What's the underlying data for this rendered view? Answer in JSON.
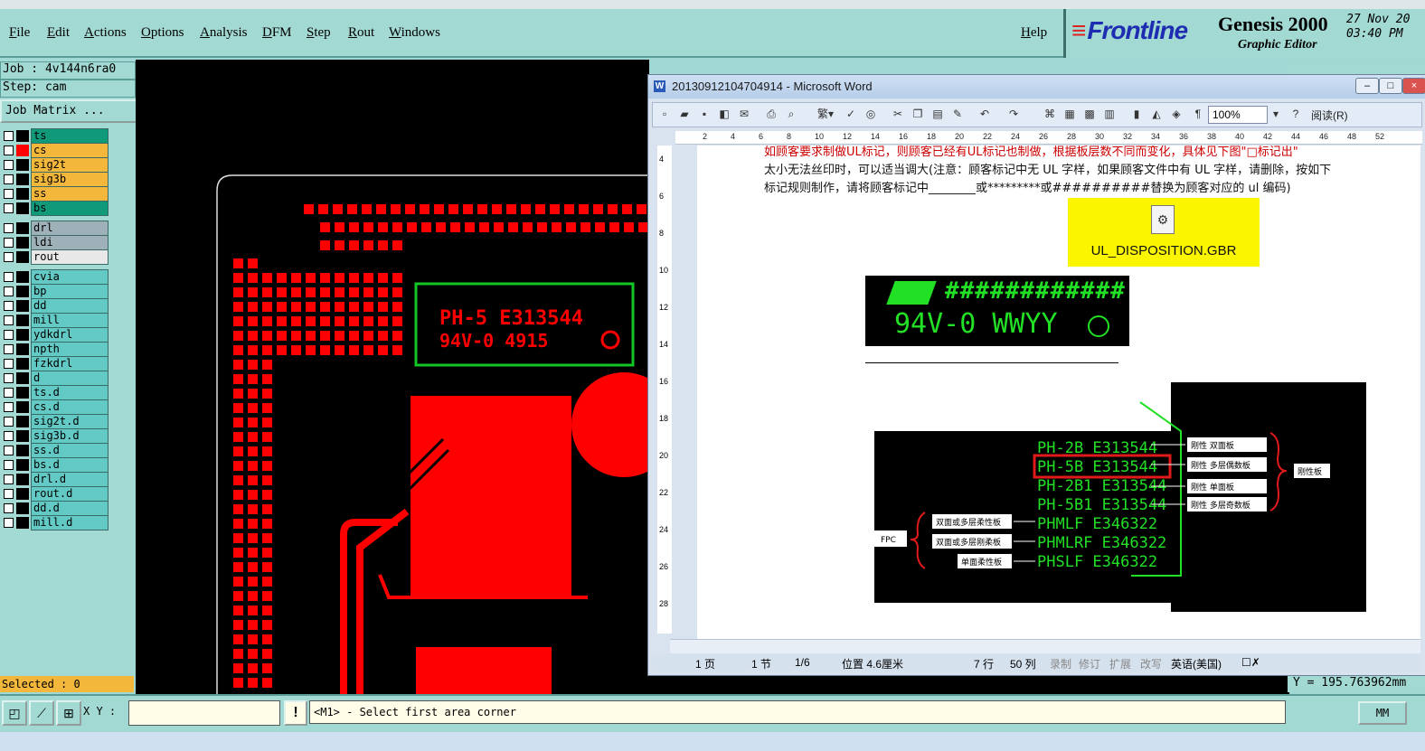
{
  "menu": {
    "items": [
      "File",
      "Edit",
      "Actions",
      "Options",
      "Analysis",
      "DFM",
      "Step",
      "Rout",
      "Windows"
    ],
    "help": "Help"
  },
  "brand": {
    "logo": "Frontline",
    "title": "Genesis 2000",
    "subtitle": "Graphic Editor",
    "date": "27 Nov 20",
    "time": "03:40 PM"
  },
  "left": {
    "job": "Job : 4v144n6ra0",
    "step": "Step: cam",
    "job_matrix": "Job Matrix ...",
    "selected": "Selected : 0",
    "layer_groups": [
      [
        {
          "name": "ts",
          "color": "#119a7a",
          "swatch": "#000000"
        },
        {
          "name": "cs",
          "color": "#f3b73b",
          "swatch": "#ff0000",
          "active": true
        },
        {
          "name": "sig2t",
          "color": "#f3b73b",
          "swatch": "#000000"
        },
        {
          "name": "sig3b",
          "color": "#f3b73b",
          "swatch": "#000000"
        },
        {
          "name": "ss",
          "color": "#f3b73b",
          "swatch": "#000000"
        },
        {
          "name": "bs",
          "color": "#119a7a",
          "swatch": "#000000"
        }
      ],
      [
        {
          "name": "drl",
          "color": "#9fb1b8",
          "swatch": "#000000"
        },
        {
          "name": "ldi",
          "color": "#9fb1b8",
          "swatch": "#000000"
        },
        {
          "name": "rout",
          "color": "#e8e8e8",
          "swatch": "#000000"
        }
      ],
      [
        {
          "name": "cvia",
          "color": "#62c9c4",
          "swatch": "#000000"
        },
        {
          "name": "bp",
          "color": "#62c9c4",
          "swatch": "#000000"
        },
        {
          "name": "dd",
          "color": "#62c9c4",
          "swatch": "#000000"
        },
        {
          "name": "mill",
          "color": "#62c9c4",
          "swatch": "#000000"
        },
        {
          "name": "ydkdrl",
          "color": "#62c9c4",
          "swatch": "#000000"
        },
        {
          "name": "npth",
          "color": "#62c9c4",
          "swatch": "#000000"
        },
        {
          "name": "fzkdrl",
          "color": "#62c9c4",
          "swatch": "#000000"
        },
        {
          "name": "d",
          "color": "#62c9c4",
          "swatch": "#000000"
        },
        {
          "name": "ts.d",
          "color": "#62c9c4",
          "swatch": "#000000"
        },
        {
          "name": "cs.d",
          "color": "#62c9c4",
          "swatch": "#000000"
        },
        {
          "name": "sig2t.d",
          "color": "#62c9c4",
          "swatch": "#000000"
        },
        {
          "name": "sig3b.d",
          "color": "#62c9c4",
          "swatch": "#000000"
        },
        {
          "name": "ss.d",
          "color": "#62c9c4",
          "swatch": "#000000"
        },
        {
          "name": "bs.d",
          "color": "#62c9c4",
          "swatch": "#000000"
        },
        {
          "name": "drl.d",
          "color": "#62c9c4",
          "swatch": "#000000"
        },
        {
          "name": "rout.d",
          "color": "#62c9c4",
          "swatch": "#000000"
        },
        {
          "name": "dd.d",
          "color": "#62c9c4",
          "swatch": "#000000"
        },
        {
          "name": "mill.d",
          "color": "#62c9c4",
          "swatch": "#000000"
        }
      ]
    ]
  },
  "canvas": {
    "marking_line1": "PH-5 E313544",
    "marking_line2": "94V-0 4915"
  },
  "word": {
    "title": "20130912104704914 - Microsoft Word",
    "zoom": "100%",
    "read_button": "阅读(R)",
    "ruler_ticks": [
      "2",
      "4",
      "6",
      "8",
      "10",
      "12",
      "14",
      "16",
      "18",
      "20",
      "22",
      "24",
      "26",
      "28",
      "30",
      "32",
      "34",
      "36",
      "38",
      "40",
      "42",
      "44",
      "46",
      "48",
      "52"
    ],
    "vruler_ticks": [
      "4",
      "6",
      "8",
      "10",
      "12",
      "14",
      "16",
      "18",
      "20",
      "22",
      "24",
      "26",
      "28"
    ],
    "para_line1": "如顾客要求制做UL标记，则顾客已经有UL标记也制做，根据板层数不同而变化，具体见下图\"□标记出\"",
    "para_line2": "太小无法丝印时，可以适当调大(注意：顾客标记中无 UL 字样，如果顾客文件中有 UL 字样，请删除，按如下",
    "para_line3": "标记规则制作，请将顾客标记中________或*********或##########替换为顾客对应的 ul 编码)",
    "attachment": "UL_DISPOSITION.GBR",
    "ul_line1": "############",
    "ul_line2": "94V-0 WWYY",
    "diagram": {
      "codes": [
        "PH-2B E313544",
        "PH-5B E313544",
        "PH-2B1 E313544",
        "PH-5B1 E313544",
        "PHMLF E346322",
        "PHMLRF E346322",
        "PHSLF E346322"
      ],
      "right_labels": [
        "刚性  双面板",
        "刚性  多层偶数板",
        "刚性  单面板",
        "刚性  多层奇数板"
      ],
      "right_group": "刚性板",
      "left_labels": [
        "双面或多层柔性板",
        "双面或多层刚柔板",
        "单面柔性板"
      ],
      "left_group": "FPC"
    },
    "status": {
      "page": "1 页",
      "section": "1 节",
      "pages": "1/6",
      "position": "位置 4.6厘米",
      "line": "7 行",
      "col": "50 列",
      "rec": "录制",
      "trk": "修订",
      "ext": "扩展",
      "ovr": "改写",
      "lang": "英语(美国)"
    }
  },
  "right": {
    "ycoord": "Y = 195.763962mm"
  },
  "bottom": {
    "xy_label": "X Y :",
    "xy_value": "",
    "message": "<M1> - Select first area corner",
    "units": "MM"
  },
  "colors": {
    "panel": "#a2d9d3",
    "copper": "#ff0000",
    "green_frame": "#13c626"
  }
}
